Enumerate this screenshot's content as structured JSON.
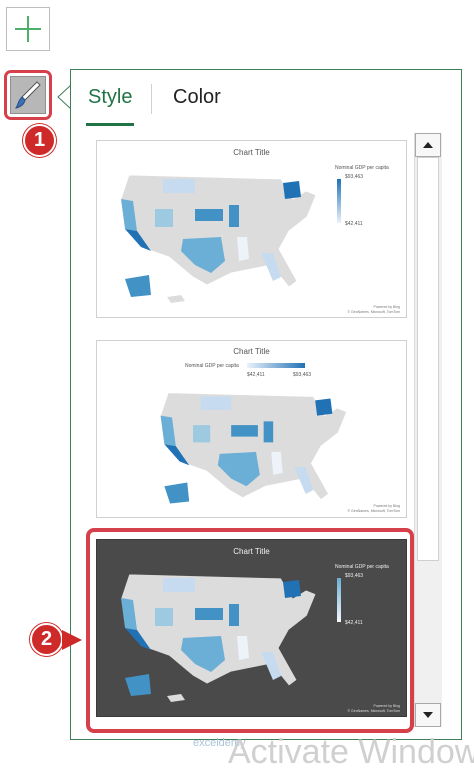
{
  "toolbar": {
    "add_icon": "plus-icon",
    "style_icon": "paintbrush-icon"
  },
  "badges": {
    "one": "1",
    "two": "2"
  },
  "tabs": [
    {
      "label": "Style",
      "active": true
    },
    {
      "label": "Color",
      "active": false
    }
  ],
  "thumbnails": [
    {
      "title": "Chart Title",
      "legend_title": "Nominal GDP per capita",
      "legend_max": "$93,463",
      "legend_min": "$42,411",
      "credit_line1": "Powered by Bing",
      "credit_line2": "© GeoNames, Microsoft, TomTom",
      "theme": "light"
    },
    {
      "title": "Chart Title",
      "legend_title": "Nominal GDP per capita",
      "legend_max": "$93,463",
      "legend_min": "$42,411",
      "credit_line1": "Powered by Bing",
      "credit_line2": "© GeoNames, Microsoft, TomTom",
      "theme": "light"
    },
    {
      "title": "Chart Title",
      "legend_title": "Nominal GDP per capita",
      "legend_max": "$93,463",
      "legend_min": "$42,411",
      "credit_line1": "Powered by Bing",
      "credit_line2": "© GeoNames, Microsoft, TomTom",
      "theme": "dark"
    }
  ],
  "watermark": {
    "logo": "exceldemy",
    "text": "Activate Window"
  },
  "colors": {
    "accent_green": "#217346",
    "highlight_red": "#d6404a",
    "map_light": "#c6dbef",
    "map_mid": "#6baed6",
    "map_dark": "#2171b5",
    "map_base": "#dcdcdc"
  }
}
